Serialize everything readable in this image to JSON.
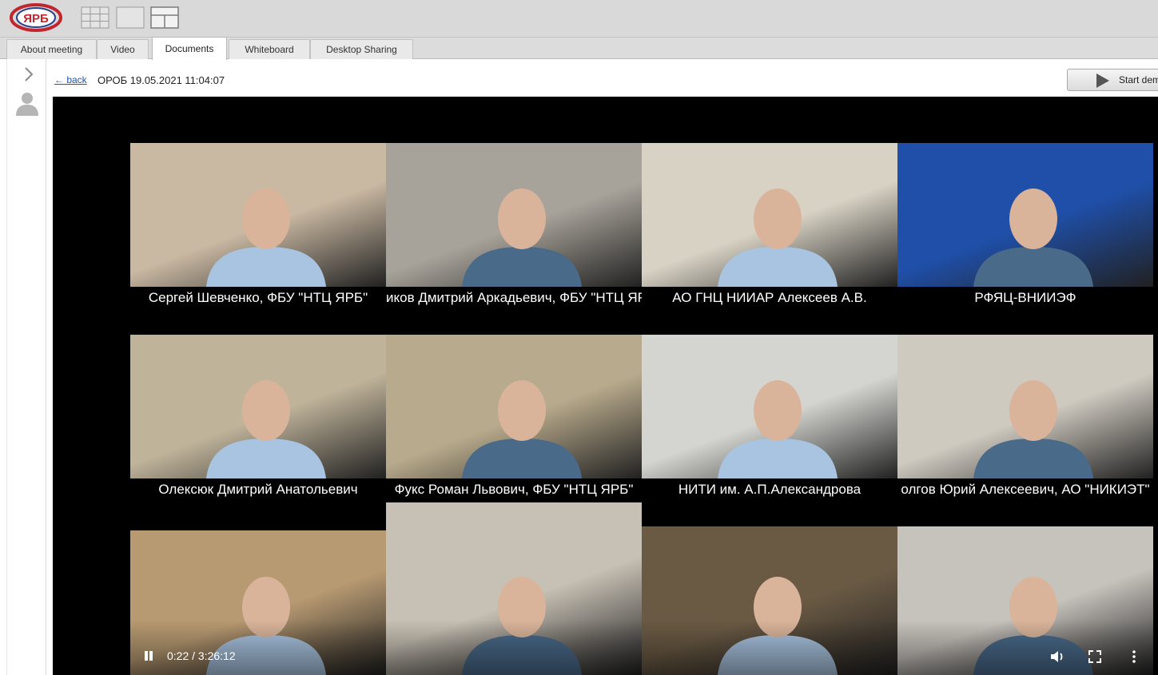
{
  "app": {
    "logo_text": "ЯРБ"
  },
  "tabs": [
    {
      "label": "About meeting"
    },
    {
      "label": "Video"
    },
    {
      "label": "Documents"
    },
    {
      "label": "Whiteboard"
    },
    {
      "label": "Desktop Sharing"
    }
  ],
  "header": {
    "back_label": "← back",
    "title": "ОРОБ 19.05.2021 11:04:07",
    "start_button_label": "Start dem"
  },
  "participants": [
    {
      "name": "Сергей Шевченко, ФБУ \"НТЦ ЯРБ\"",
      "bg": "#c9b8a2"
    },
    {
      "name": "иков Дмитрий Аркадьевич, ФБУ \"НТЦ ЯРБ\"",
      "bg": "#a8a39a"
    },
    {
      "name": "АО ГНЦ НИИАР Алексеев А.В.",
      "bg": "#d8d2c4"
    },
    {
      "name": "РФЯЦ-ВНИИЭФ",
      "bg": "#1f4fa8"
    },
    {
      "name": "Олексюк Дмитрий Анатольевич",
      "bg": "#bfb39a"
    },
    {
      "name": "Фукс Роман Львович, ФБУ \"НТЦ ЯРБ\"",
      "bg": "#b8aa8c"
    },
    {
      "name": "НИТИ им. А.П.Александрова",
      "bg": "#d4d4d0"
    },
    {
      "name": "олгов Юрий Алексеевич, АО \"НИКИЭТ\"",
      "bg": "#cfcac0"
    },
    {
      "name": "",
      "bg": "#b89a72"
    },
    {
      "name": "",
      "bg": "#c7c0b4"
    },
    {
      "name": "",
      "bg": "#6a5a44"
    },
    {
      "name": "",
      "bg": "#c6c2bc"
    }
  ],
  "player": {
    "time": "0:22 / 3:26:12"
  },
  "colors": {
    "video_bg": "#000000",
    "link": "#2255aa"
  }
}
